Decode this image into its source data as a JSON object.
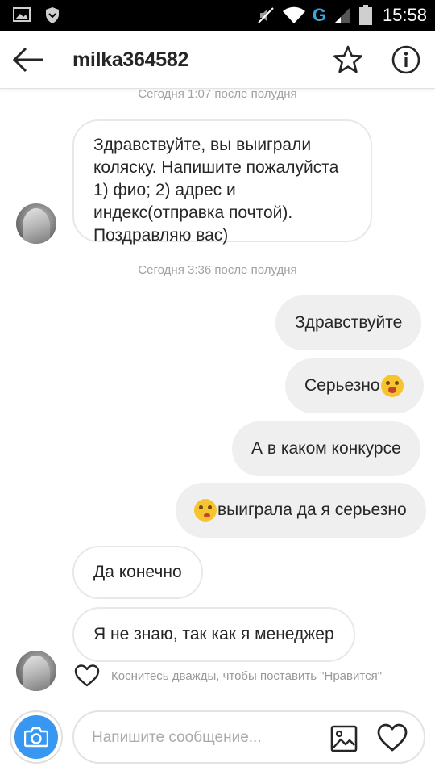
{
  "status_bar": {
    "time": "15:58",
    "network": "G",
    "icons": [
      "gallery-notification-icon",
      "shield-notification-icon",
      "mute-icon",
      "wifi-icon",
      "signal-icon",
      "battery-icon"
    ]
  },
  "header": {
    "username": "milka364582",
    "icons": [
      "back-arrow-icon",
      "star-icon",
      "info-icon"
    ]
  },
  "conversation": {
    "timestamp_1": "Сегодня 1:07 после полудня",
    "msg_1": "Здравствуйте, вы выиграли коляску. Напишите пожалуйста 1) фио; 2) адрес и индекс(отправка почтой). Поздравляю вас)",
    "timestamp_2": "Сегодня 3:36 после полудня",
    "msg_2": "Здравствуйте",
    "msg_3": "Серьезно",
    "msg_4": "А в каком конкурсе",
    "msg_5": "выиграла да я серьезно",
    "msg_6": "Да конечно",
    "msg_7": "Я не знаю, так как я менеджер",
    "like_hint": "Коснитесь дважды, чтобы поставить \"Нравится\""
  },
  "composer": {
    "placeholder": "Напишите сообщение...",
    "icons": [
      "camera-icon",
      "gallery-icon",
      "heart-icon"
    ]
  },
  "colors": {
    "accent": "#3897f0",
    "outgoing_bubble": "#efefef",
    "incoming_border": "#e8e8e8",
    "timestamp": "#a2a2a2"
  }
}
